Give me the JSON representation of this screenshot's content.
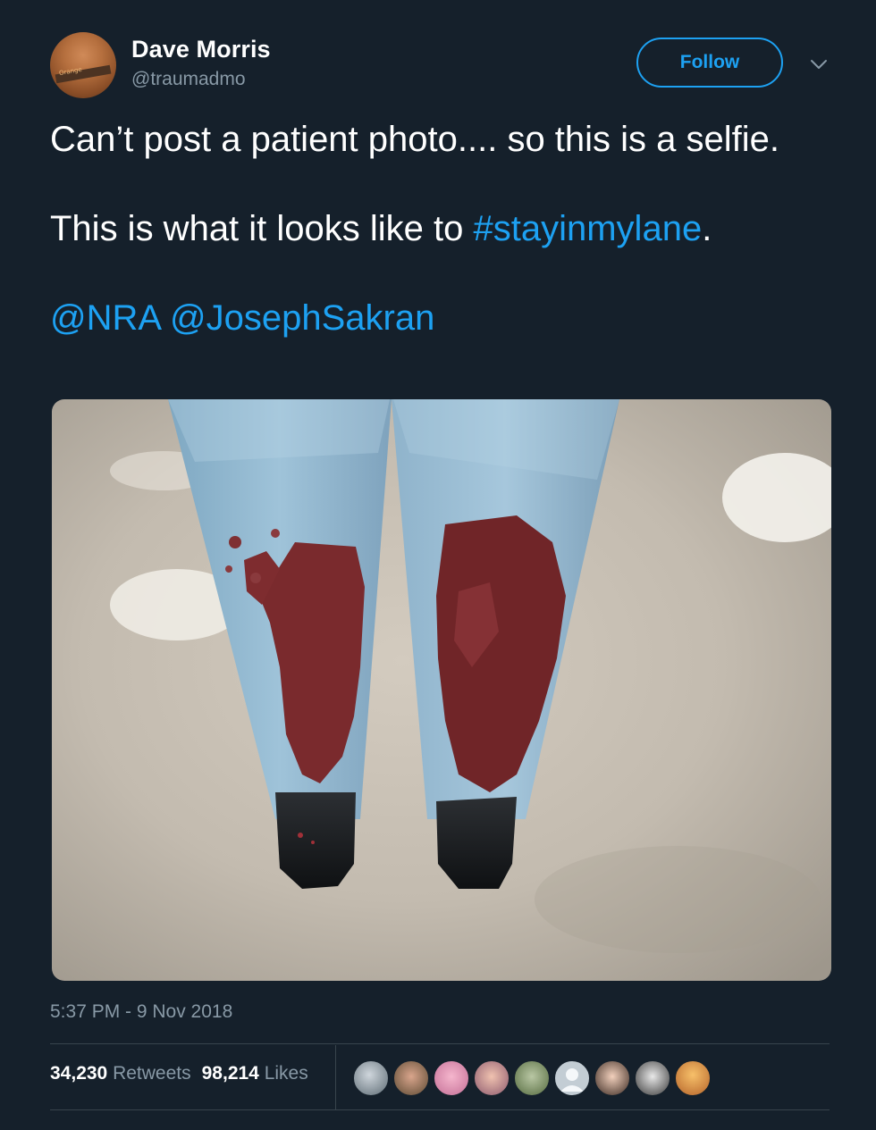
{
  "tweet": {
    "author": {
      "name": "Dave Morris",
      "handle": "@traumadmo",
      "avatar_badge_text": "Orange"
    },
    "follow_label": "Follow",
    "text": {
      "line1": "Can’t post a patient photo.... so this is a selfie.",
      "line2_before": "This is what it looks like to ",
      "hashtag": "#stayinmylane",
      "line2_after": ".",
      "mention1": "@NRA",
      "mention2": "@JosephSakran"
    },
    "timestamp": "5:37 PM - 9 Nov 2018",
    "stats": {
      "retweets_count": "34,230",
      "retweets_label": "Retweets",
      "likes_count": "98,214",
      "likes_label": "Likes"
    }
  },
  "colors": {
    "background": "#15202b",
    "accent": "#1da1f2",
    "secondary_text": "#8899a6",
    "divider": "#38444d"
  },
  "icons": [
    "chevron-down-icon"
  ]
}
